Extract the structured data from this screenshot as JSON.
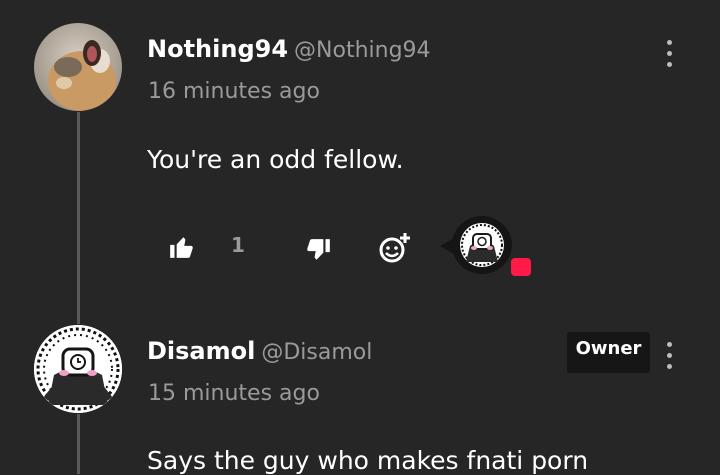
{
  "comments": [
    {
      "author": "Nothing94",
      "handle": "@Nothing94",
      "time": "16 minutes ago",
      "text": "You're an odd fellow.",
      "likes": "1"
    },
    {
      "author": "Disamol",
      "handle": "@Disamol",
      "badge": "Owner",
      "time": "15 minutes ago",
      "text": "Says the guy who makes fnati porn"
    }
  ],
  "colors": {
    "background": "#262626",
    "text_secondary": "#9a9a9a",
    "notification": "#ff1a4a"
  }
}
